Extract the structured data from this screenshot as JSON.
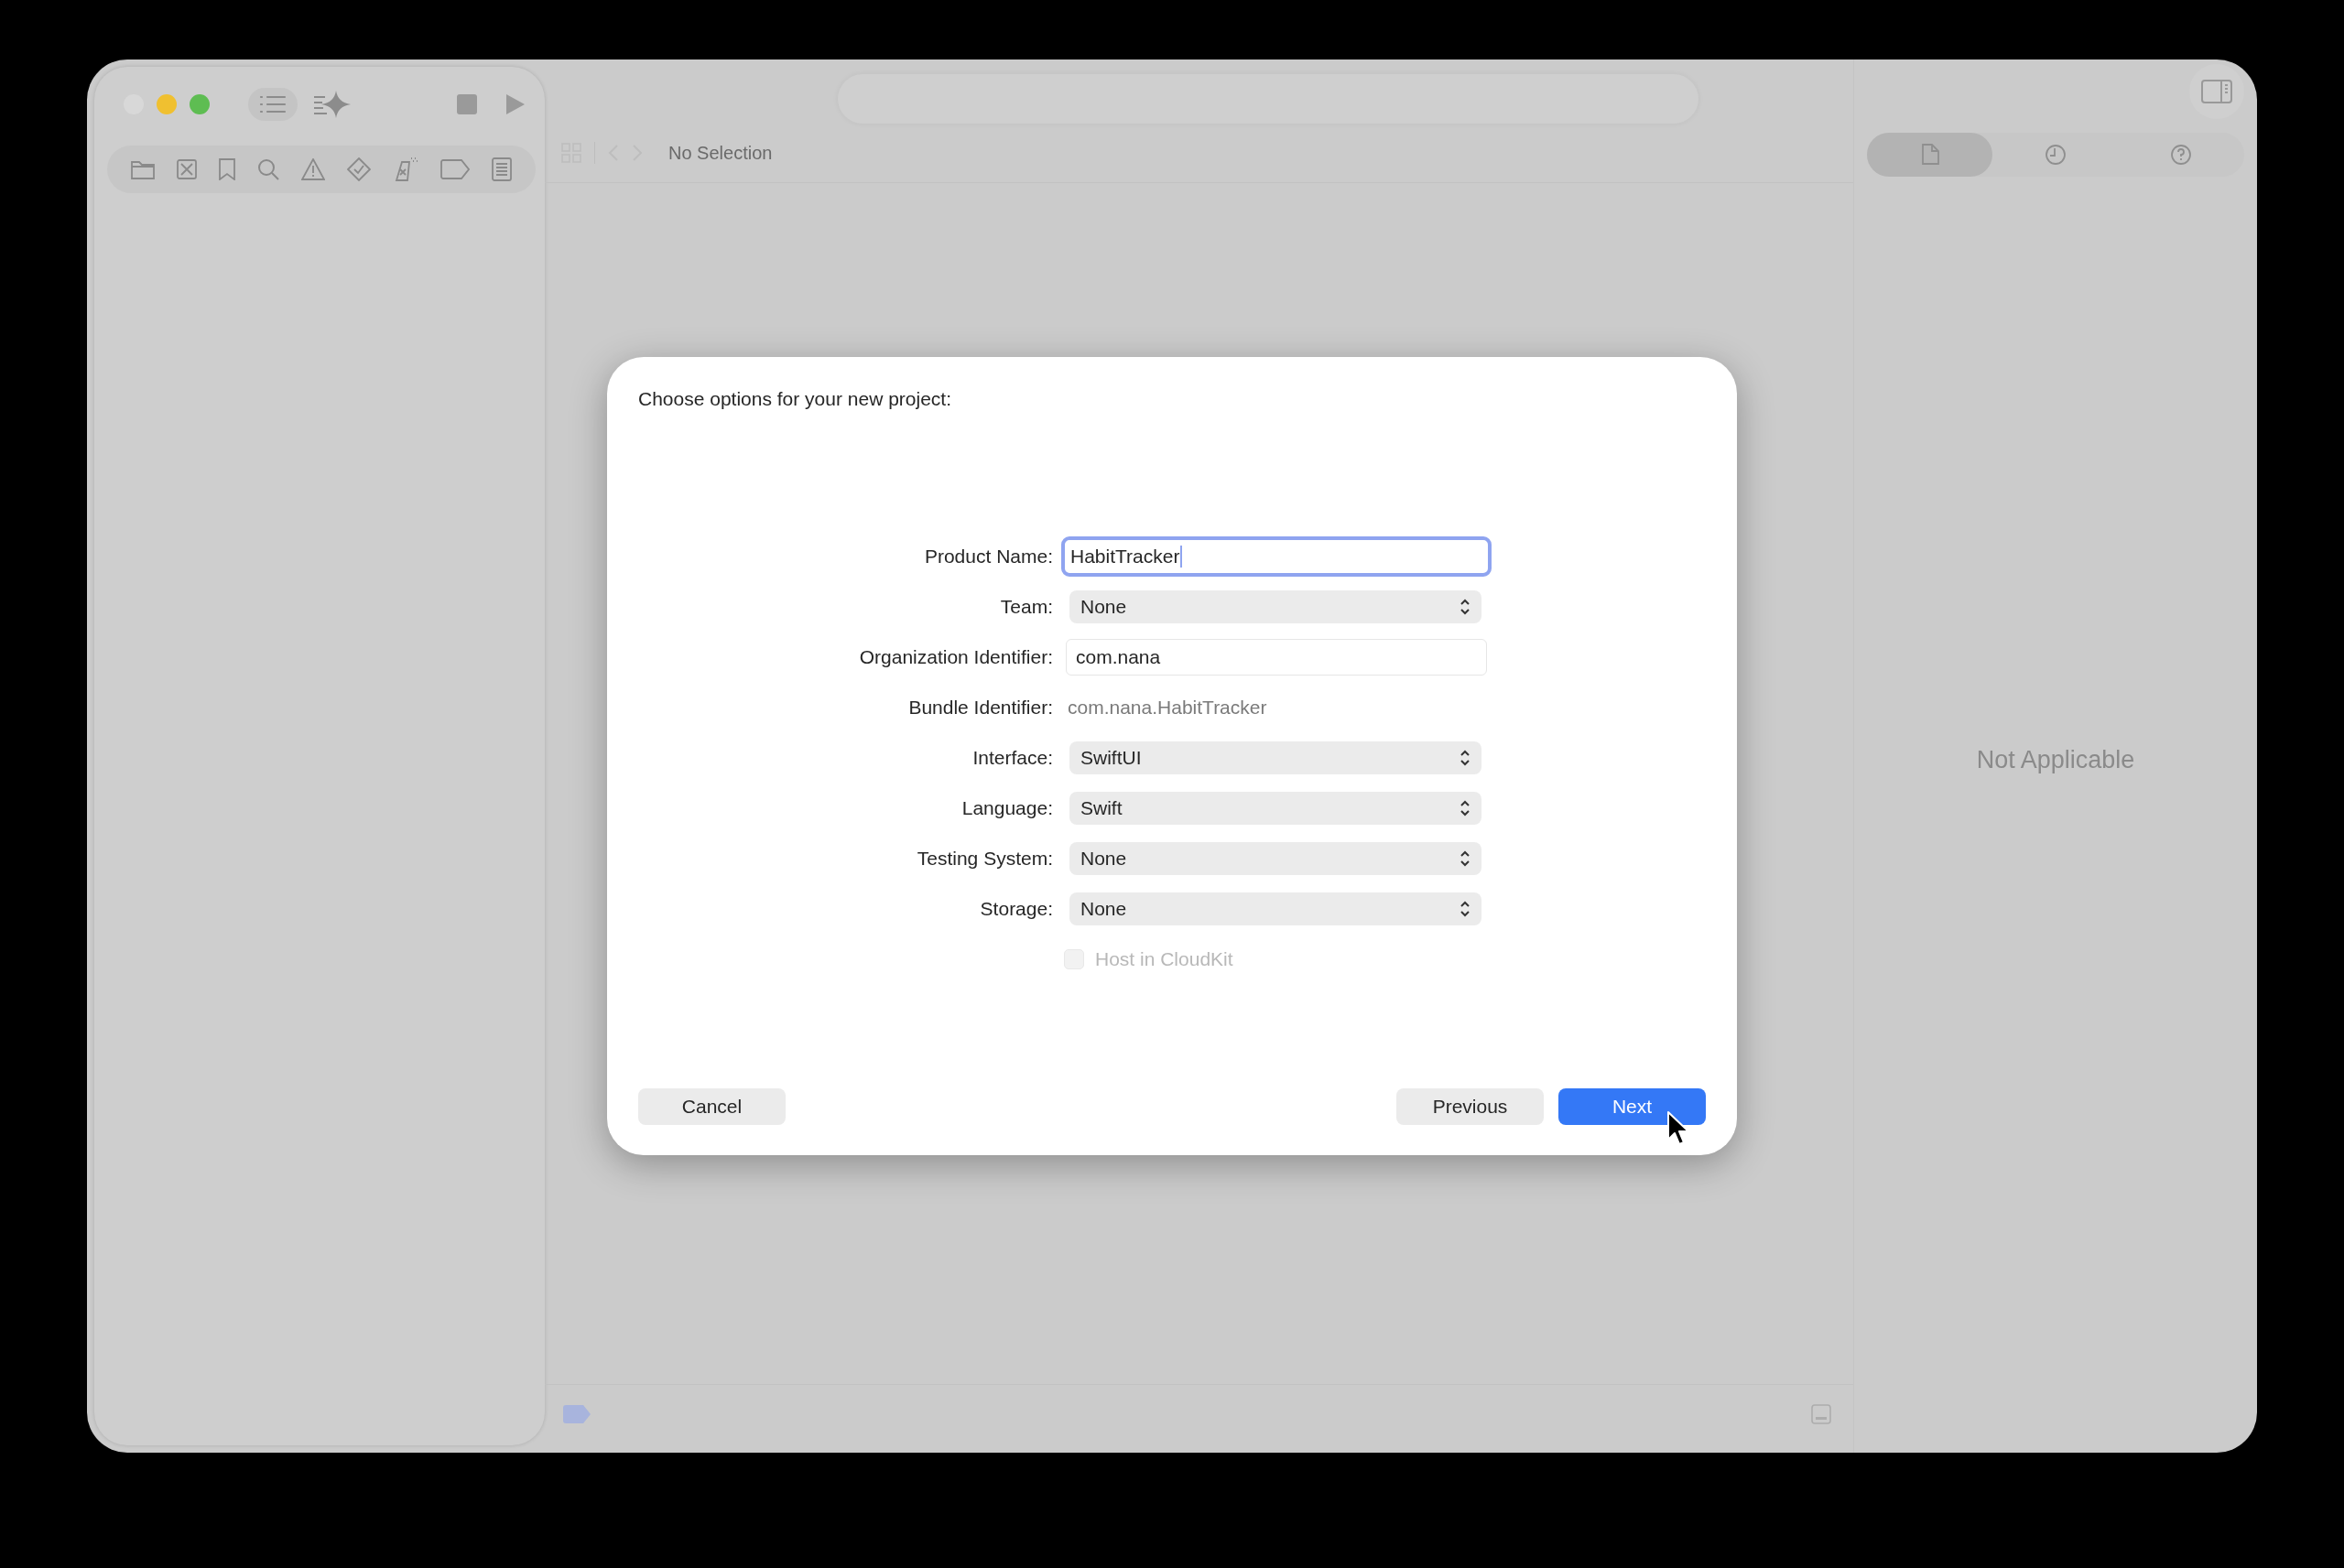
{
  "editor": {
    "breadcrumb": "No Selection"
  },
  "inspector": {
    "tabs": [
      {
        "kind": "file",
        "selected": true
      },
      {
        "kind": "history",
        "selected": false
      },
      {
        "kind": "help",
        "selected": false
      }
    ],
    "message": "Not Applicable"
  },
  "dialog": {
    "title": "Choose options for your new project:",
    "fields": [
      {
        "kind": "text",
        "label": "Product Name:",
        "value": "HabitTracker",
        "focused": true
      },
      {
        "kind": "popup",
        "label": "Team:",
        "value": "None"
      },
      {
        "kind": "text",
        "label": "Organization Identifier:",
        "value": "com.nana",
        "focused": false
      },
      {
        "kind": "static",
        "label": "Bundle Identifier:",
        "value": "com.nana.HabitTracker"
      },
      {
        "kind": "popup",
        "label": "Interface:",
        "value": "SwiftUI"
      },
      {
        "kind": "popup",
        "label": "Language:",
        "value": "Swift"
      },
      {
        "kind": "popup",
        "label": "Testing System:",
        "value": "None"
      },
      {
        "kind": "popup",
        "label": "Storage:",
        "value": "None"
      }
    ],
    "checkbox": {
      "label": "Host in CloudKit",
      "checked": false,
      "disabled": true
    },
    "buttons": [
      {
        "label": "Cancel",
        "default": false
      },
      {
        "label": "Previous",
        "default": false
      },
      {
        "label": "Next",
        "default": true
      }
    ]
  }
}
